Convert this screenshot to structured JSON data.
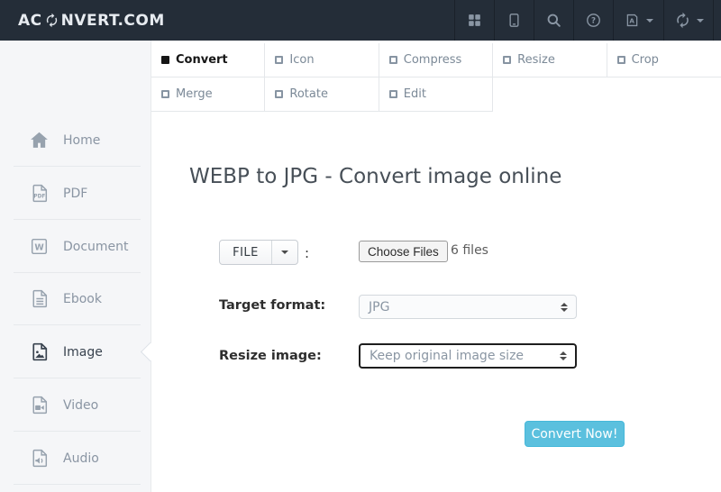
{
  "header": {
    "logo_prefix": "AC",
    "logo_suffix": "NVERT.COM",
    "logo_icon": "sync-icon",
    "nav_icons": [
      "apps-grid-icon",
      "mobile-icon",
      "search-icon",
      "help-icon",
      "language-icon",
      "refresh-icon"
    ]
  },
  "tabs": {
    "items": [
      {
        "label": "Convert",
        "active": true
      },
      {
        "label": "Icon",
        "active": false
      },
      {
        "label": "Compress",
        "active": false
      },
      {
        "label": "Resize",
        "active": false
      },
      {
        "label": "Crop",
        "active": false
      },
      {
        "label": "Merge",
        "active": false
      },
      {
        "label": "Rotate",
        "active": false
      },
      {
        "label": "Edit",
        "active": false
      }
    ]
  },
  "sidebar": {
    "items": [
      {
        "label": "Home",
        "icon": "home-icon",
        "active": false
      },
      {
        "label": "PDF",
        "icon": "pdf-file-icon",
        "active": false
      },
      {
        "label": "Document",
        "icon": "word-file-icon",
        "active": false
      },
      {
        "label": "Ebook",
        "icon": "ebook-file-icon",
        "active": false
      },
      {
        "label": "Image",
        "icon": "image-file-icon",
        "active": true
      },
      {
        "label": "Video",
        "icon": "video-file-icon",
        "active": false
      },
      {
        "label": "Audio",
        "icon": "audio-file-icon",
        "active": false
      }
    ]
  },
  "main": {
    "heading": "WEBP to JPG - Convert image online",
    "file_row": {
      "source_button_label": "FILE",
      "separator": ":",
      "choose_files_label": "Choose Files",
      "files_status": "6 files"
    },
    "target_format": {
      "label": "Target format:",
      "value": "JPG"
    },
    "resize_image": {
      "label": "Resize image:",
      "value": "Keep original image size"
    },
    "convert_button_label": "Convert Now!"
  },
  "colors": {
    "accent": "#5bc0de",
    "accent_border": "#46b8da",
    "header_bg": "#242d38",
    "sidebar_bg": "#f5f6f8",
    "border": "#e4e7ea",
    "muted_text": "#8a95a3",
    "dark_text": "#39434f"
  }
}
